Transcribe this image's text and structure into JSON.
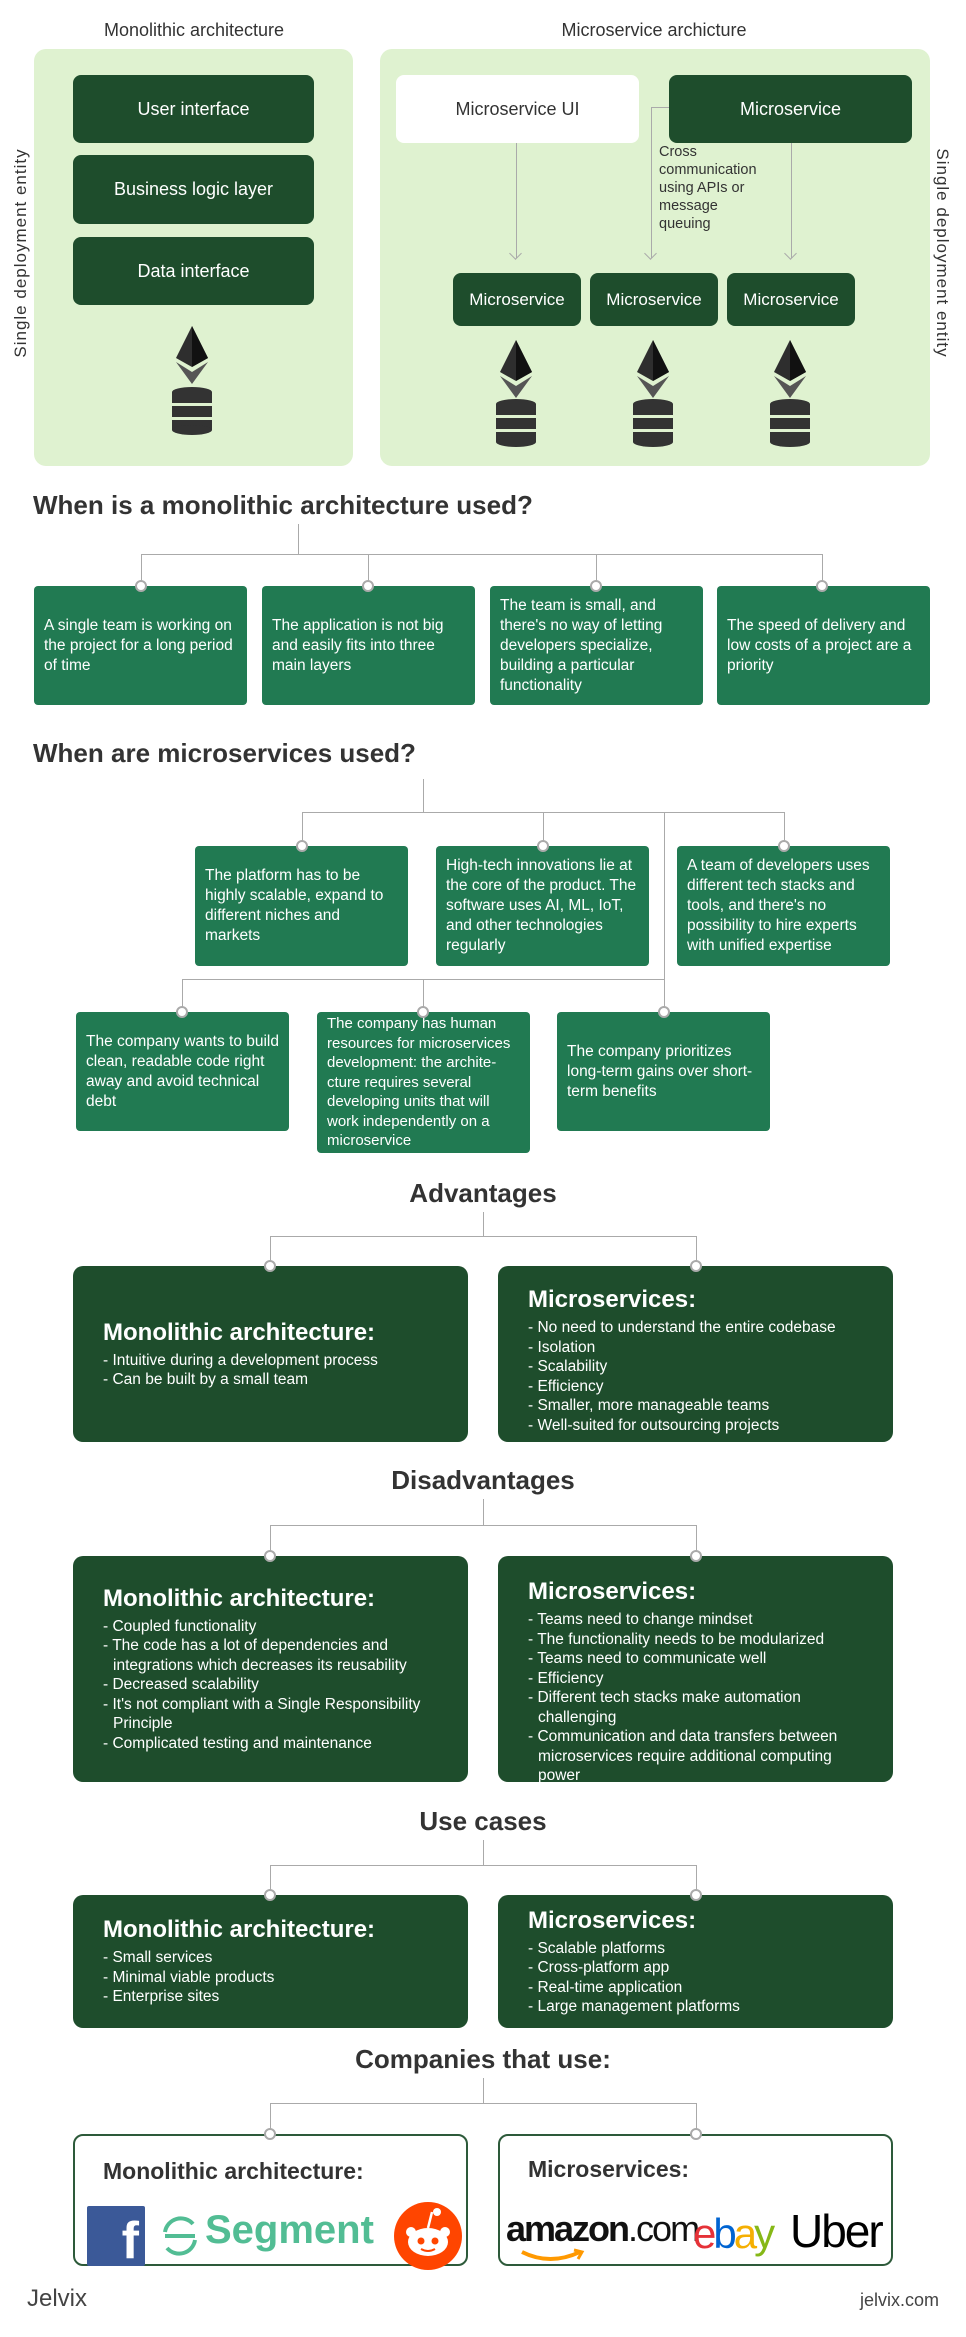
{
  "diagram": {
    "mono_title": "Monolithic architecture",
    "micro_title": "Microservice archicture",
    "side_label": "Single deployment entity",
    "mono_layers": [
      "User interface",
      "Business logic layer",
      "Data interface"
    ],
    "micro_ui": "Microservice UI",
    "micro_top": "Microservice",
    "cross_note": "Cross communication using APIs or message queuing",
    "micro_bottom": [
      "Microservice",
      "Microservice",
      "Microservice"
    ]
  },
  "mono_used": {
    "title": "When is a monolithic architecture used?",
    "items": [
      "A single team is working on the project for a long period of time",
      "The application is not big and easily fits into three main layers",
      "The team is small, and there's no way of letting developers specialize, building a particular functionality",
      "The speed of delivery and low costs of a project are a priority"
    ]
  },
  "micro_used": {
    "title": "When are microservices used?",
    "items": [
      "The platform has to be highly scalable, expand to different niches and markets",
      "High-tech innovations lie at the core of the product. The software uses AI, ML, IoT, and other technologies regularly",
      "A team of developers uses different tech stacks and tools, and there's no possibility to hire experts with unified expertise",
      "The company wants to build clean, readable code right away and avoid technical debt",
      "The company has human resources for microservices development: the archite-cture requires several developing units that will work independently on a microservice",
      "The company prioritizes long-term gains over short-term benefits"
    ]
  },
  "advantages": {
    "title": "Advantages",
    "mono": {
      "title": "Monolithic architecture:",
      "items": [
        "- Intuitive during a development process",
        "- Can be built by a small team"
      ]
    },
    "micro": {
      "title": "Microservices:",
      "items": [
        "- No need to understand the entire codebase",
        "- Isolation",
        "- Scalability",
        "- Efficiency",
        "- Smaller, more manageable teams",
        "- Well-suited for outsourcing projects"
      ]
    }
  },
  "disadvantages": {
    "title": "Disadvantages",
    "mono": {
      "title": "Monolithic architecture:",
      "items": [
        "- Coupled functionality",
        "- The code has a lot of dependencies and integrations which decreases its reusability",
        "- Decreased scalability",
        "- It's not compliant with a Single Responsibility Principle",
        "- Complicated testing and maintenance"
      ]
    },
    "micro": {
      "title": "Microservices:",
      "items": [
        "- Teams need to change mindset",
        "- The functionality needs to be modularized",
        "- Teams need to communicate well",
        "- Efficiency",
        "- Different tech stacks make automation challenging",
        "- Communication and data transfers between microservices require additional computing power"
      ]
    }
  },
  "use_cases": {
    "title": "Use cases",
    "mono": {
      "title": "Monolithic architecture:",
      "items": [
        "- Small services",
        "- Minimal viable products",
        "- Enterprise sites"
      ]
    },
    "micro": {
      "title": "Microservices:",
      "items": [
        "- Scalable platforms",
        "- Cross-platform app",
        "- Real-time application",
        "- Large management platforms"
      ]
    }
  },
  "companies": {
    "title": "Companies that use:",
    "mono": {
      "title": "Monolithic architecture:",
      "logos": [
        "Facebook",
        "Segment",
        "Reddit"
      ]
    },
    "micro": {
      "title": "Microservices:",
      "logos": [
        "amazon.com",
        "ebay",
        "Uber"
      ]
    }
  },
  "footer": {
    "brand": "Jelvix",
    "site": "jelvix.com"
  },
  "colors": {
    "dark_green": "#1e4d2c",
    "green": "#217a52",
    "panel": "#dff2d0"
  }
}
